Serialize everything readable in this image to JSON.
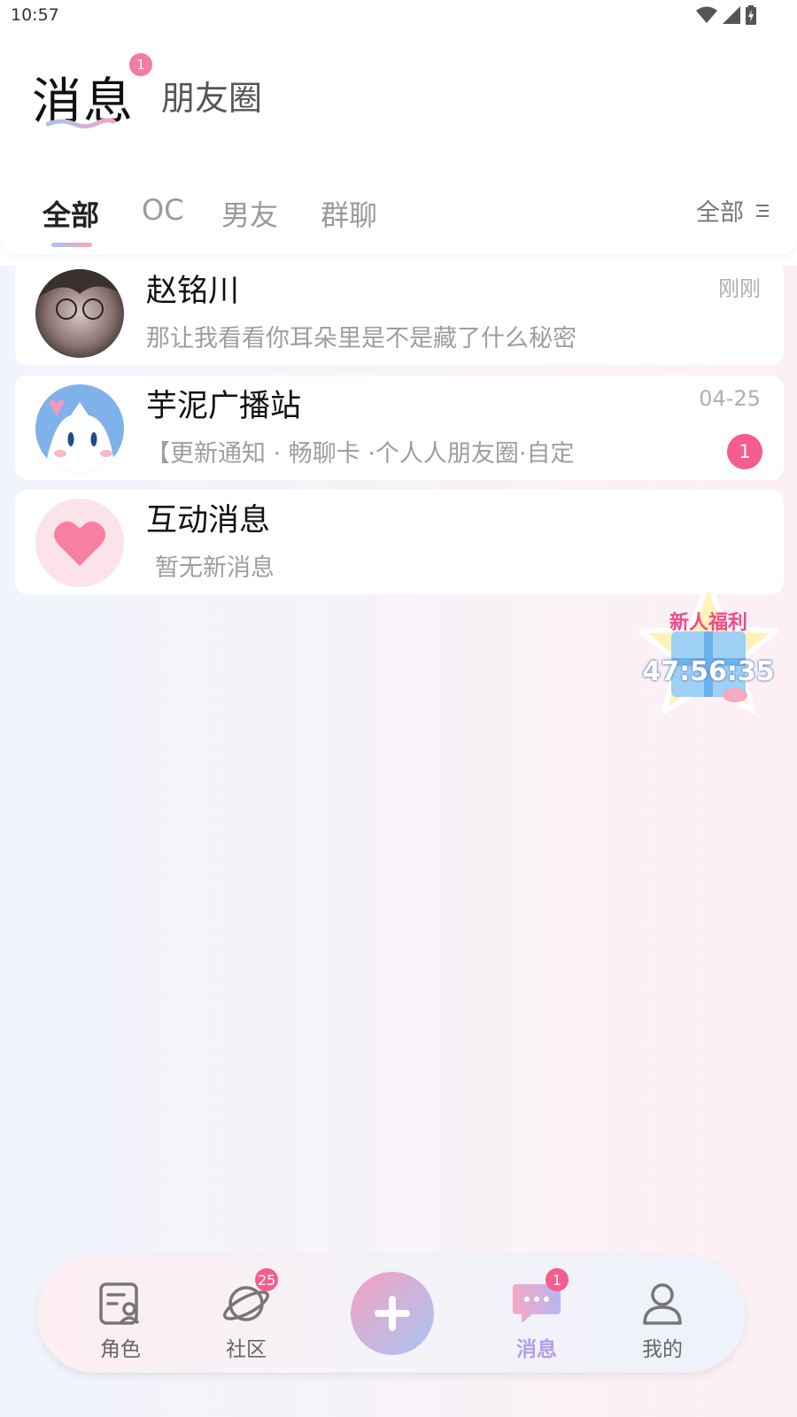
{
  "status_bar": {
    "time": "10:57"
  },
  "header": {
    "tab_messages": "消息",
    "tab_messages_badge": "1",
    "tab_moments": "朋友圈"
  },
  "filters": {
    "tabs": [
      "全部",
      "OC",
      "男友",
      "群聊"
    ],
    "active_index": 0,
    "right_label": "全部"
  },
  "conversations": [
    {
      "name": "赵铭川",
      "time": "刚刚",
      "preview": "那让我看看你耳朵里是不是藏了什么秘密",
      "badge": ""
    },
    {
      "name": "芋泥广播站",
      "time": "04-25",
      "preview": "【更新通知 · 畅聊卡 ·个人人朋友圈·自定",
      "badge": "1"
    },
    {
      "name": "互动消息",
      "time": "",
      "preview": "暂无新消息",
      "badge": ""
    }
  ],
  "promo": {
    "title": "新人福利",
    "timer": "47:56:35"
  },
  "bottom_nav": {
    "items": [
      {
        "label": "角色",
        "badge": ""
      },
      {
        "label": "社区",
        "badge": "25"
      },
      {
        "label": "消息",
        "badge": "1"
      },
      {
        "label": "我的",
        "badge": ""
      }
    ],
    "active_label": "消息"
  },
  "colors": {
    "accent_pink": "#f45d8d",
    "accent_blue": "#a8c6f4",
    "active_nav": "#b49ee8"
  }
}
